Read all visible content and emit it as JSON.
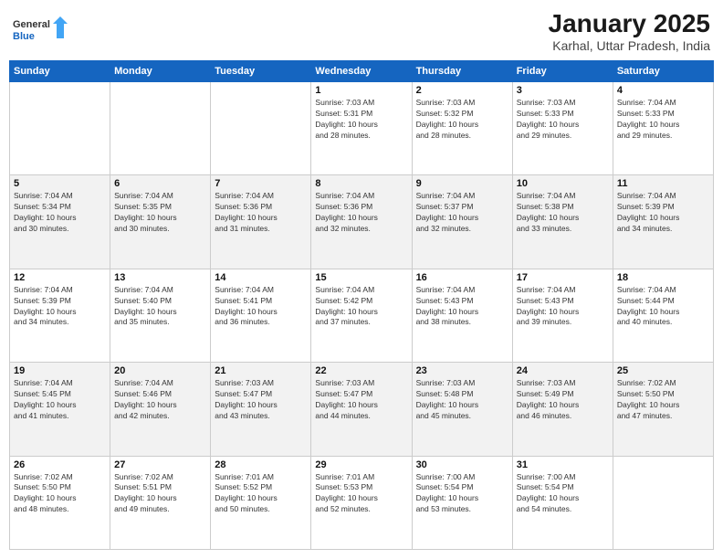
{
  "header": {
    "logo_line1": "General",
    "logo_line2": "Blue",
    "month_title": "January 2025",
    "location": "Karhal, Uttar Pradesh, India"
  },
  "weekdays": [
    "Sunday",
    "Monday",
    "Tuesday",
    "Wednesday",
    "Thursday",
    "Friday",
    "Saturday"
  ],
  "weeks": [
    [
      {
        "day": "",
        "info": ""
      },
      {
        "day": "",
        "info": ""
      },
      {
        "day": "",
        "info": ""
      },
      {
        "day": "1",
        "info": "Sunrise: 7:03 AM\nSunset: 5:31 PM\nDaylight: 10 hours\nand 28 minutes."
      },
      {
        "day": "2",
        "info": "Sunrise: 7:03 AM\nSunset: 5:32 PM\nDaylight: 10 hours\nand 28 minutes."
      },
      {
        "day": "3",
        "info": "Sunrise: 7:03 AM\nSunset: 5:33 PM\nDaylight: 10 hours\nand 29 minutes."
      },
      {
        "day": "4",
        "info": "Sunrise: 7:04 AM\nSunset: 5:33 PM\nDaylight: 10 hours\nand 29 minutes."
      }
    ],
    [
      {
        "day": "5",
        "info": "Sunrise: 7:04 AM\nSunset: 5:34 PM\nDaylight: 10 hours\nand 30 minutes."
      },
      {
        "day": "6",
        "info": "Sunrise: 7:04 AM\nSunset: 5:35 PM\nDaylight: 10 hours\nand 30 minutes."
      },
      {
        "day": "7",
        "info": "Sunrise: 7:04 AM\nSunset: 5:36 PM\nDaylight: 10 hours\nand 31 minutes."
      },
      {
        "day": "8",
        "info": "Sunrise: 7:04 AM\nSunset: 5:36 PM\nDaylight: 10 hours\nand 32 minutes."
      },
      {
        "day": "9",
        "info": "Sunrise: 7:04 AM\nSunset: 5:37 PM\nDaylight: 10 hours\nand 32 minutes."
      },
      {
        "day": "10",
        "info": "Sunrise: 7:04 AM\nSunset: 5:38 PM\nDaylight: 10 hours\nand 33 minutes."
      },
      {
        "day": "11",
        "info": "Sunrise: 7:04 AM\nSunset: 5:39 PM\nDaylight: 10 hours\nand 34 minutes."
      }
    ],
    [
      {
        "day": "12",
        "info": "Sunrise: 7:04 AM\nSunset: 5:39 PM\nDaylight: 10 hours\nand 34 minutes."
      },
      {
        "day": "13",
        "info": "Sunrise: 7:04 AM\nSunset: 5:40 PM\nDaylight: 10 hours\nand 35 minutes."
      },
      {
        "day": "14",
        "info": "Sunrise: 7:04 AM\nSunset: 5:41 PM\nDaylight: 10 hours\nand 36 minutes."
      },
      {
        "day": "15",
        "info": "Sunrise: 7:04 AM\nSunset: 5:42 PM\nDaylight: 10 hours\nand 37 minutes."
      },
      {
        "day": "16",
        "info": "Sunrise: 7:04 AM\nSunset: 5:43 PM\nDaylight: 10 hours\nand 38 minutes."
      },
      {
        "day": "17",
        "info": "Sunrise: 7:04 AM\nSunset: 5:43 PM\nDaylight: 10 hours\nand 39 minutes."
      },
      {
        "day": "18",
        "info": "Sunrise: 7:04 AM\nSunset: 5:44 PM\nDaylight: 10 hours\nand 40 minutes."
      }
    ],
    [
      {
        "day": "19",
        "info": "Sunrise: 7:04 AM\nSunset: 5:45 PM\nDaylight: 10 hours\nand 41 minutes."
      },
      {
        "day": "20",
        "info": "Sunrise: 7:04 AM\nSunset: 5:46 PM\nDaylight: 10 hours\nand 42 minutes."
      },
      {
        "day": "21",
        "info": "Sunrise: 7:03 AM\nSunset: 5:47 PM\nDaylight: 10 hours\nand 43 minutes."
      },
      {
        "day": "22",
        "info": "Sunrise: 7:03 AM\nSunset: 5:47 PM\nDaylight: 10 hours\nand 44 minutes."
      },
      {
        "day": "23",
        "info": "Sunrise: 7:03 AM\nSunset: 5:48 PM\nDaylight: 10 hours\nand 45 minutes."
      },
      {
        "day": "24",
        "info": "Sunrise: 7:03 AM\nSunset: 5:49 PM\nDaylight: 10 hours\nand 46 minutes."
      },
      {
        "day": "25",
        "info": "Sunrise: 7:02 AM\nSunset: 5:50 PM\nDaylight: 10 hours\nand 47 minutes."
      }
    ],
    [
      {
        "day": "26",
        "info": "Sunrise: 7:02 AM\nSunset: 5:50 PM\nDaylight: 10 hours\nand 48 minutes."
      },
      {
        "day": "27",
        "info": "Sunrise: 7:02 AM\nSunset: 5:51 PM\nDaylight: 10 hours\nand 49 minutes."
      },
      {
        "day": "28",
        "info": "Sunrise: 7:01 AM\nSunset: 5:52 PM\nDaylight: 10 hours\nand 50 minutes."
      },
      {
        "day": "29",
        "info": "Sunrise: 7:01 AM\nSunset: 5:53 PM\nDaylight: 10 hours\nand 52 minutes."
      },
      {
        "day": "30",
        "info": "Sunrise: 7:00 AM\nSunset: 5:54 PM\nDaylight: 10 hours\nand 53 minutes."
      },
      {
        "day": "31",
        "info": "Sunrise: 7:00 AM\nSunset: 5:54 PM\nDaylight: 10 hours\nand 54 minutes."
      },
      {
        "day": "",
        "info": ""
      }
    ]
  ]
}
